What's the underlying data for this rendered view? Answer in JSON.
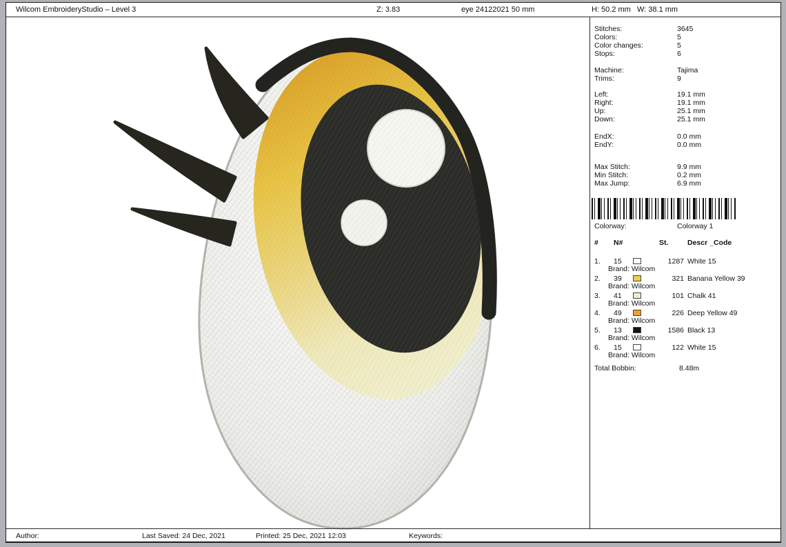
{
  "header": {
    "app_title": "Wilcom EmbroideryStudio – Level 3",
    "zoom_level": "Z: 3.83",
    "design_name": "eye 24122021 50 mm",
    "size_h": "H: 50.2 mm",
    "size_w": "W: 38.1 mm"
  },
  "panel": {
    "stats": [
      {
        "label": "Stitches:",
        "value": "3645"
      },
      {
        "label": "Colors:",
        "value": "5"
      },
      {
        "label": "Color changes:",
        "value": "5"
      },
      {
        "label": "Stops:",
        "value": "6"
      },
      {
        "label": "Machine:",
        "value": "Tajima"
      },
      {
        "label": "Trims:",
        "value": "9"
      },
      {
        "label": "Left:",
        "value": "19.1 mm"
      },
      {
        "label": "Right:",
        "value": "19.1 mm"
      },
      {
        "label": "Up:",
        "value": "25.1 mm"
      },
      {
        "label": "Down:",
        "value": "25.1 mm"
      },
      {
        "label": "EndX:",
        "value": "0.0 mm"
      },
      {
        "label": "EndY:",
        "value": "0.0 mm"
      },
      {
        "label": "Max Stitch:",
        "value": "9.9 mm"
      },
      {
        "label": "Min Stitch:",
        "value": "0.2 mm"
      },
      {
        "label": "Max Jump:",
        "value": "6.9 mm"
      }
    ],
    "colorway": {
      "label": "Colorway:",
      "value": "Colorway 1"
    },
    "thread_table": {
      "headers": {
        "num": "#",
        "n": "N#",
        "st": "St.",
        "desc": "Descr _Code"
      },
      "rows": [
        {
          "num": "1.",
          "n": "15",
          "color": "#ffffff",
          "st": "1287",
          "desc": "White 15",
          "brand": "Brand: Wilcom"
        },
        {
          "num": "2.",
          "n": "39",
          "color": "#eace4e",
          "st": "321",
          "desc": "Banana Yellow 39",
          "brand": "Brand: Wilcom"
        },
        {
          "num": "3.",
          "n": "41",
          "color": "#f1edc3",
          "st": "101",
          "desc": "Chalk 41",
          "brand": "Brand: Wilcom"
        },
        {
          "num": "4.",
          "n": "49",
          "color": "#e6a426",
          "st": "226",
          "desc": "Deep Yellow 49",
          "brand": "Brand: Wilcom"
        },
        {
          "num": "5.",
          "n": "13",
          "color": "#141414",
          "st": "1586",
          "desc": "Black 13",
          "brand": "Brand: Wilcom"
        },
        {
          "num": "6.",
          "n": "15",
          "color": "#ffffff",
          "st": "122",
          "desc": "White 15",
          "brand": "Brand: Wilcom"
        }
      ],
      "total": {
        "label": "Total Bobbin:",
        "value": "8.48m"
      }
    }
  },
  "footer": {
    "author_label": "Author:",
    "last_saved": "Last Saved: 24 Dec, 2021",
    "printed": "Printed: 25 Dec, 2021 12:03",
    "keywords_label": "Keywords:"
  }
}
